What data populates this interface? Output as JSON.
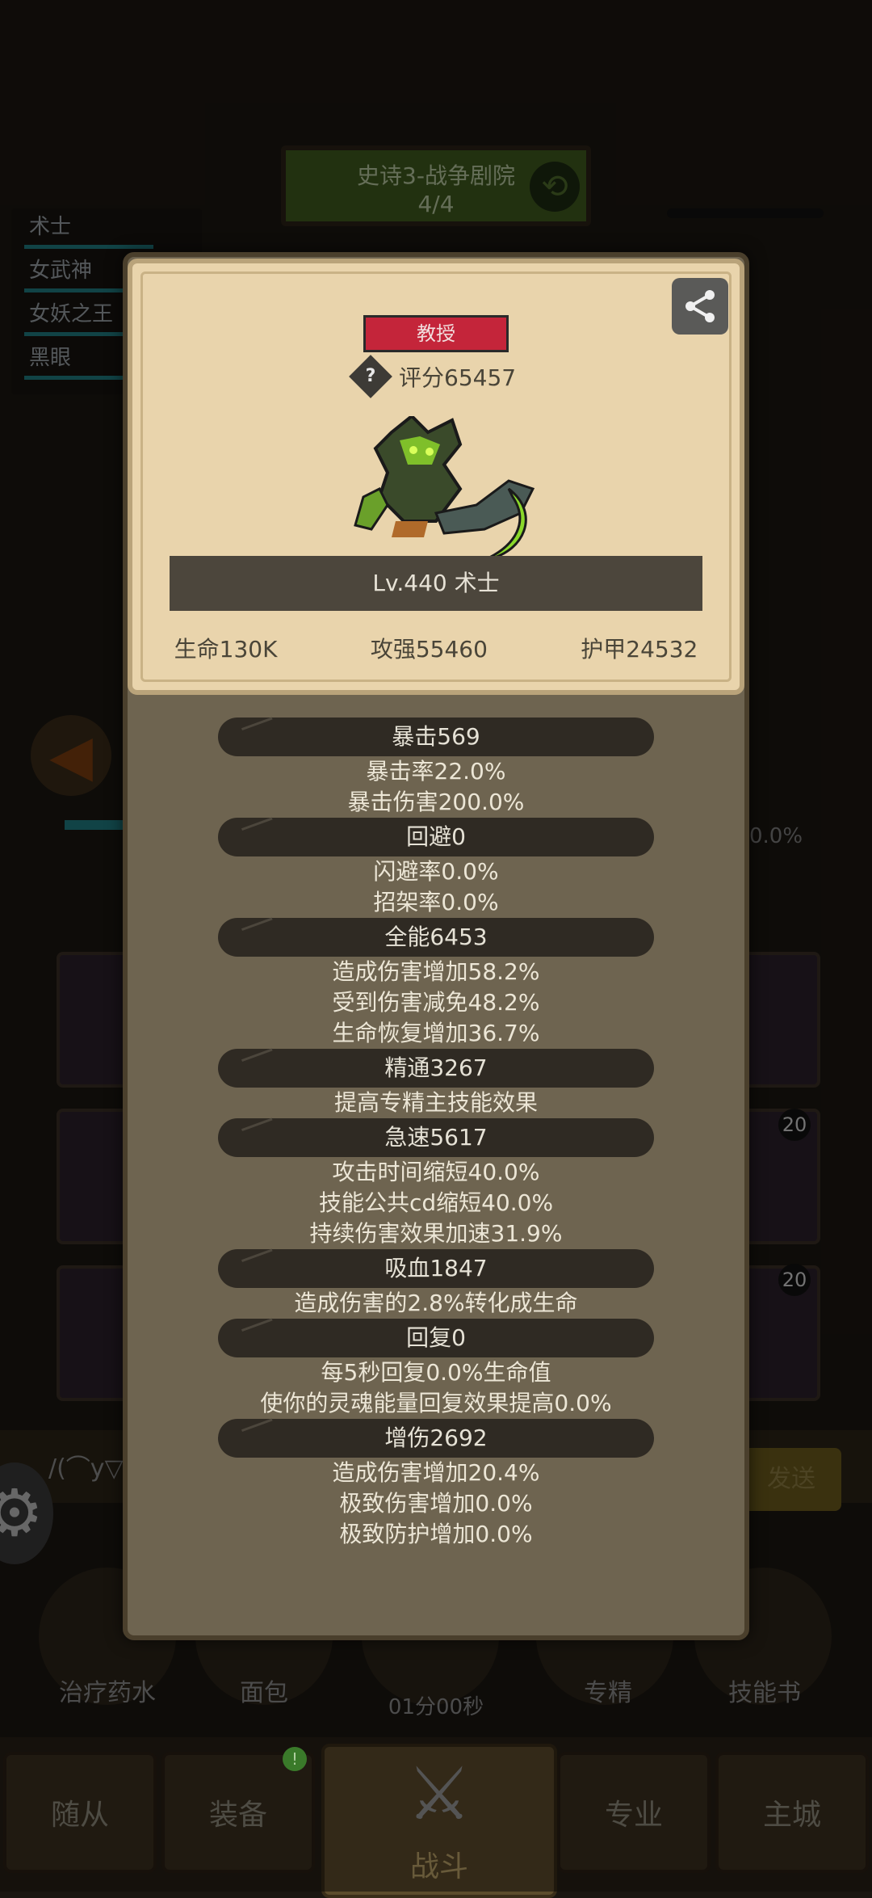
{
  "stage": {
    "title": "史诗3-战争剧院",
    "progress": "4/4"
  },
  "party": [
    "术士",
    "女武神",
    "女妖之王",
    "黑眼"
  ],
  "background": {
    "percent_right": "0.0%",
    "badges": [
      "20",
      "20"
    ],
    "chat_placeholder": "/(⌒y▽/",
    "send_label": "发送",
    "skills": [
      "治疗药水",
      "面包",
      "专精",
      "技能书"
    ],
    "timer": "01分00秒",
    "nav": {
      "followers": "随从",
      "equipment": "装备",
      "battle": "战斗",
      "profession": "专业",
      "city": "主城",
      "equipment_dot": "!"
    }
  },
  "panel": {
    "rank": "教授",
    "score": "评分65457",
    "level_name": "Lv.440 术士",
    "stats": {
      "hp": "生命130K",
      "attack": "攻强55460",
      "armor": "护甲24532"
    },
    "groups": [
      {
        "header": "暴击569",
        "lines": [
          "暴击率22.0%",
          "暴击伤害200.0%"
        ]
      },
      {
        "header": "回避0",
        "lines": [
          "闪避率0.0%",
          "招架率0.0%"
        ]
      },
      {
        "header": "全能6453",
        "lines": [
          "造成伤害增加58.2%",
          "受到伤害减免48.2%",
          "生命恢复增加36.7%"
        ]
      },
      {
        "header": "精通3267",
        "lines": [
          "提高专精主技能效果"
        ]
      },
      {
        "header": "急速5617",
        "lines": [
          "攻击时间缩短40.0%",
          "技能公共cd缩短40.0%",
          "持续伤害效果加速31.9%"
        ]
      },
      {
        "header": "吸血1847",
        "lines": [
          "造成伤害的2.8%转化成生命"
        ]
      },
      {
        "header": "回复0",
        "lines": [
          "每5秒回复0.0%生命值",
          "使你的灵魂能量回复效果提高0.0%"
        ]
      },
      {
        "header": "增伤2692",
        "lines": [
          "造成伤害增加20.4%",
          "极致伤害增加0.0%",
          "极致防护增加0.0%"
        ]
      }
    ]
  }
}
